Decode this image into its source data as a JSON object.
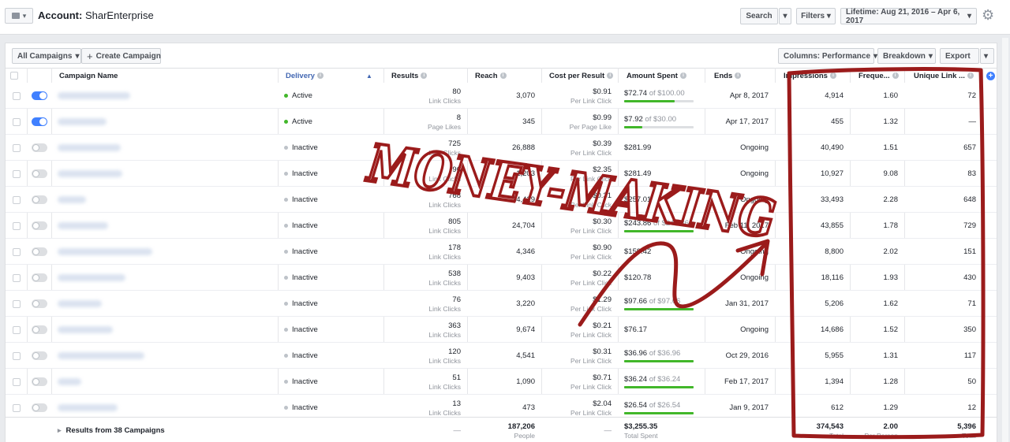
{
  "header": {
    "account_label": "Account:",
    "account_name": "SharEnterprise",
    "search_label": "Search",
    "filters_label": "Filters",
    "date_range_label": "Lifetime: Aug 21, 2016 – Apr 6, 2017"
  },
  "toolbar": {
    "all_campaigns_label": "All Campaigns",
    "create_campaign_label": "Create Campaign",
    "columns_label": "Columns: Performance",
    "breakdown_label": "Breakdown",
    "export_label": "Export"
  },
  "columns": {
    "campaign_name": "Campaign Name",
    "delivery": "Delivery",
    "results": "Results",
    "reach": "Reach",
    "cost_per_result": "Cost per Result",
    "amount_spent": "Amount Spent",
    "ends": "Ends",
    "impressions": "Impressions",
    "frequency": "Freque...",
    "unique_link": "Unique Link ..."
  },
  "rows": [
    {
      "on": true,
      "delivery": "Active",
      "status_color": "#42b72a",
      "results": "80",
      "results_sub": "Link Clicks",
      "reach": "3,070",
      "cost": "$0.91",
      "cost_sub": "Per Link Click",
      "spent": "$72.74",
      "budget_text": " of $100.00",
      "budget_fraction": 0.727,
      "ends": "Apr 8, 2017",
      "impressions": "4,914",
      "frequency": "1.60",
      "unique": "72"
    },
    {
      "on": true,
      "delivery": "Active",
      "status_color": "#42b72a",
      "results": "8",
      "results_sub": "Page Likes",
      "reach": "345",
      "cost": "$0.99",
      "cost_sub": "Per Page Like",
      "spent": "$7.92",
      "budget_text": " of $30.00",
      "budget_fraction": 0.264,
      "ends": "Apr 17, 2017",
      "impressions": "455",
      "frequency": "1.32",
      "unique": "—"
    },
    {
      "on": false,
      "delivery": "Inactive",
      "status_color": "#bec3c9",
      "results": "725",
      "results_sub": "Link Clicks",
      "reach": "26,888",
      "cost": "$0.39",
      "cost_sub": "Per Link Click",
      "spent": "$281.99",
      "budget_text": "",
      "budget_fraction": null,
      "ends": "Ongoing",
      "impressions": "40,490",
      "frequency": "1.51",
      "unique": "657"
    },
    {
      "on": false,
      "delivery": "Inactive",
      "status_color": "#bec3c9",
      "results": "96",
      "results_sub": "Link Clicks",
      "reach": "1,203",
      "cost": "$2.35",
      "cost_sub": "Per Link Click",
      "spent": "$281.49",
      "budget_text": "",
      "budget_fraction": null,
      "ends": "Ongoing",
      "impressions": "10,927",
      "frequency": "9.08",
      "unique": "83"
    },
    {
      "on": false,
      "delivery": "Inactive",
      "status_color": "#bec3c9",
      "results": "768",
      "results_sub": "Link Clicks",
      "reach": "14,429",
      "cost": "$0.31",
      "cost_sub": "Per Link Click",
      "spent": "$257.01",
      "budget_text": "",
      "budget_fraction": null,
      "ends": "Ongoing",
      "impressions": "33,493",
      "frequency": "2.28",
      "unique": "648"
    },
    {
      "on": false,
      "delivery": "Inactive",
      "status_color": "#bec3c9",
      "results": "805",
      "results_sub": "Link Clicks",
      "reach": "24,704",
      "cost": "$0.30",
      "cost_sub": "Per Link Click",
      "spent": "$243.86",
      "budget_text": " of $243.86",
      "budget_fraction": 1.0,
      "ends": "Feb 11, 2017",
      "impressions": "43,855",
      "frequency": "1.78",
      "unique": "729"
    },
    {
      "on": false,
      "delivery": "Inactive",
      "status_color": "#bec3c9",
      "results": "178",
      "results_sub": "Link Clicks",
      "reach": "4,346",
      "cost": "$0.90",
      "cost_sub": "Per Link Click",
      "spent": "$159.42",
      "budget_text": "",
      "budget_fraction": null,
      "ends": "Ongoing",
      "impressions": "8,800",
      "frequency": "2.02",
      "unique": "151"
    },
    {
      "on": false,
      "delivery": "Inactive",
      "status_color": "#bec3c9",
      "results": "538",
      "results_sub": "Link Clicks",
      "reach": "9,403",
      "cost": "$0.22",
      "cost_sub": "Per Link Click",
      "spent": "$120.78",
      "budget_text": "",
      "budget_fraction": null,
      "ends": "Ongoing",
      "impressions": "18,116",
      "frequency": "1.93",
      "unique": "430"
    },
    {
      "on": false,
      "delivery": "Inactive",
      "status_color": "#bec3c9",
      "results": "76",
      "results_sub": "Link Clicks",
      "reach": "3,220",
      "cost": "$1.29",
      "cost_sub": "Per Link Click",
      "spent": "$97.66",
      "budget_text": " of $97.66",
      "budget_fraction": 1.0,
      "ends": "Jan 31, 2017",
      "impressions": "5,206",
      "frequency": "1.62",
      "unique": "71"
    },
    {
      "on": false,
      "delivery": "Inactive",
      "status_color": "#bec3c9",
      "results": "363",
      "results_sub": "Link Clicks",
      "reach": "9,674",
      "cost": "$0.21",
      "cost_sub": "Per Link Click",
      "spent": "$76.17",
      "budget_text": "",
      "budget_fraction": null,
      "ends": "Ongoing",
      "impressions": "14,686",
      "frequency": "1.52",
      "unique": "350"
    },
    {
      "on": false,
      "delivery": "Inactive",
      "status_color": "#bec3c9",
      "results": "120",
      "results_sub": "Link Clicks",
      "reach": "4,541",
      "cost": "$0.31",
      "cost_sub": "Per Link Click",
      "spent": "$36.96",
      "budget_text": " of $36.96",
      "budget_fraction": 1.0,
      "ends": "Oct 29, 2016",
      "impressions": "5,955",
      "frequency": "1.31",
      "unique": "117"
    },
    {
      "on": false,
      "delivery": "Inactive",
      "status_color": "#bec3c9",
      "results": "51",
      "results_sub": "Link Clicks",
      "reach": "1,090",
      "cost": "$0.71",
      "cost_sub": "Per Link Click",
      "spent": "$36.24",
      "budget_text": " of $36.24",
      "budget_fraction": 1.0,
      "ends": "Feb 17, 2017",
      "impressions": "1,394",
      "frequency": "1.28",
      "unique": "50"
    },
    {
      "on": false,
      "delivery": "Inactive",
      "status_color": "#bec3c9",
      "results": "13",
      "results_sub": "Link Clicks",
      "reach": "473",
      "cost": "$2.04",
      "cost_sub": "Per Link Click",
      "spent": "$26.54",
      "budget_text": " of $26.54",
      "budget_fraction": 1.0,
      "ends": "Jan 9, 2017",
      "impressions": "612",
      "frequency": "1.29",
      "unique": "12"
    }
  ],
  "footer": {
    "label": "Results from 38 Campaigns",
    "results": "—",
    "reach": "187,206",
    "reach_sub": "People",
    "cost": "—",
    "spent": "$3,255.35",
    "spent_sub": "Total Spent",
    "impressions": "374,543",
    "impressions_sub": "Total",
    "frequency": "2.00",
    "frequency_sub": "Per Person",
    "unique": "5,396",
    "unique_sub": "Total"
  },
  "annotation": {
    "text": "MONEY-MAKING",
    "color": "#9b1b1b"
  },
  "icons": {
    "settings": "gear-icon",
    "plus": "plus-icon",
    "caret": "caret-down-icon",
    "info": "info-icon",
    "sort": "sort-up-icon",
    "add_column": "plus-circle-icon"
  },
  "colors": {
    "active_dot": "#42b72a",
    "inactive_dot": "#bec3c9",
    "toggle_on": "#4080ff",
    "progress": "#42b72a"
  }
}
